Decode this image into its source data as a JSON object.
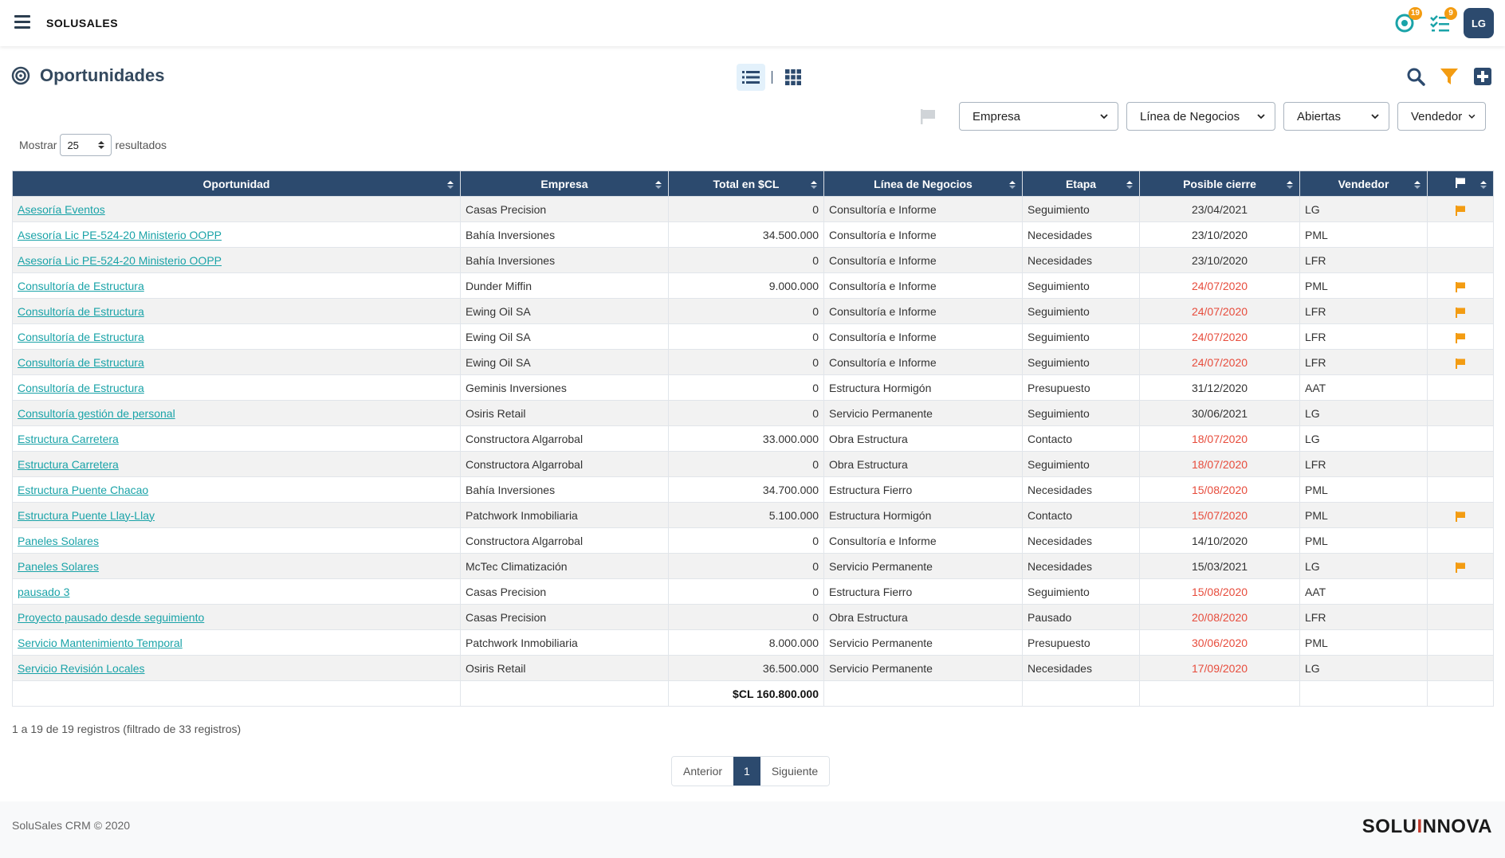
{
  "app": {
    "brand": "SOLUSALES",
    "user_initials": "LG",
    "badges": {
      "activity": "19",
      "tasks": "9"
    }
  },
  "page": {
    "title": "Oportunidades",
    "show_prefix": "Mostrar",
    "show_value": "25",
    "show_suffix": "resultados"
  },
  "filters": {
    "empresa": "Empresa",
    "linea": "Línea de Negocios",
    "estado": "Abiertas",
    "vendedor": "Vendedor"
  },
  "table": {
    "headers": [
      "Oportunidad",
      "Empresa",
      "Total en $CL",
      "Línea de Negocios",
      "Etapa",
      "Posible cierre",
      "Vendedor"
    ],
    "rows": [
      {
        "oportunidad": " Asesoría Eventos",
        "empresa": "Casas Precision",
        "total": "0",
        "linea": "Consultoría e Informe",
        "etapa": "Seguimiento",
        "cierre": "23/04/2021",
        "vendedor": "LG",
        "flag": true,
        "overdue": false
      },
      {
        "oportunidad": " Asesoría Lic PE-524-20 Ministerio OOPP",
        "empresa": "Bahía Inversiones",
        "total": "34.500.000",
        "linea": "Consultoría e Informe",
        "etapa": "Necesidades",
        "cierre": "23/10/2020",
        "vendedor": "PML",
        "flag": false,
        "overdue": false
      },
      {
        "oportunidad": " Asesoría Lic PE-524-20 Ministerio OOPP",
        "empresa": "Bahía Inversiones",
        "total": "0",
        "linea": "Consultoría e Informe",
        "etapa": "Necesidades",
        "cierre": "23/10/2020",
        "vendedor": "LFR",
        "flag": false,
        "overdue": false
      },
      {
        "oportunidad": " Consultoría de Estructura",
        "empresa": "Dunder Miffin",
        "total": "9.000.000",
        "linea": "Consultoría e Informe",
        "etapa": "Seguimiento",
        "cierre": "24/07/2020",
        "vendedor": "PML",
        "flag": true,
        "overdue": true
      },
      {
        "oportunidad": " Consultoría de Estructura",
        "empresa": "Ewing Oil SA",
        "total": "0",
        "linea": "Consultoría e Informe",
        "etapa": "Seguimiento",
        "cierre": "24/07/2020",
        "vendedor": "LFR",
        "flag": true,
        "overdue": true
      },
      {
        "oportunidad": " Consultoría de Estructura",
        "empresa": "Ewing Oil SA",
        "total": "0",
        "linea": "Consultoría e Informe",
        "etapa": "Seguimiento",
        "cierre": "24/07/2020",
        "vendedor": "LFR",
        "flag": true,
        "overdue": true
      },
      {
        "oportunidad": " Consultoría de Estructura",
        "empresa": "Ewing Oil SA",
        "total": "0",
        "linea": "Consultoría e Informe",
        "etapa": "Seguimiento",
        "cierre": "24/07/2020",
        "vendedor": "LFR",
        "flag": true,
        "overdue": true
      },
      {
        "oportunidad": " Consultoría de Estructura",
        "empresa": "Geminis Inversiones",
        "total": "0",
        "linea": "Estructura Hormigón",
        "etapa": "Presupuesto",
        "cierre": "31/12/2020",
        "vendedor": "AAT",
        "flag": false,
        "overdue": false
      },
      {
        "oportunidad": " Consultoría gestión de personal",
        "empresa": "Osiris Retail",
        "total": "0",
        "linea": "Servicio Permanente",
        "etapa": "Seguimiento",
        "cierre": "30/06/2021",
        "vendedor": "LG",
        "flag": false,
        "overdue": false
      },
      {
        "oportunidad": " Estructura Carretera",
        "empresa": "Constructora Algarrobal",
        "total": "33.000.000",
        "linea": "Obra Estructura",
        "etapa": "Contacto",
        "cierre": "18/07/2020",
        "vendedor": "LG",
        "flag": false,
        "overdue": true
      },
      {
        "oportunidad": " Estructura Carretera",
        "empresa": "Constructora Algarrobal",
        "total": "0",
        "linea": "Obra Estructura",
        "etapa": "Seguimiento",
        "cierre": "18/07/2020",
        "vendedor": "LFR",
        "flag": false,
        "overdue": true
      },
      {
        "oportunidad": " Estructura Puente Chacao",
        "empresa": "Bahía Inversiones",
        "total": "34.700.000",
        "linea": "Estructura Fierro",
        "etapa": "Necesidades",
        "cierre": "15/08/2020",
        "vendedor": "PML",
        "flag": false,
        "overdue": true
      },
      {
        "oportunidad": " Estructura Puente Llay-Llay",
        "empresa": "Patchwork Inmobiliaria",
        "total": "5.100.000",
        "linea": "Estructura Hormigón",
        "etapa": "Contacto",
        "cierre": "15/07/2020",
        "vendedor": "PML",
        "flag": true,
        "overdue": true
      },
      {
        "oportunidad": " Paneles Solares",
        "empresa": "Constructora Algarrobal",
        "total": "0",
        "linea": "Consultoría e Informe",
        "etapa": "Necesidades",
        "cierre": "14/10/2020",
        "vendedor": "PML",
        "flag": false,
        "overdue": false
      },
      {
        "oportunidad": " Paneles Solares",
        "empresa": "McTec Climatización",
        "total": "0",
        "linea": "Servicio Permanente",
        "etapa": "Necesidades",
        "cierre": "15/03/2021",
        "vendedor": "LG",
        "flag": true,
        "overdue": false
      },
      {
        "oportunidad": " pausado 3",
        "empresa": "Casas Precision",
        "total": "0",
        "linea": "Estructura Fierro",
        "etapa": "Seguimiento",
        "cierre": "15/08/2020",
        "vendedor": "AAT",
        "flag": false,
        "overdue": true
      },
      {
        "oportunidad": " Proyecto pausado desde seguimiento",
        "empresa": "Casas Precision",
        "total": "0",
        "linea": "Obra Estructura",
        "etapa": "Pausado",
        "cierre": "20/08/2020",
        "vendedor": "LFR",
        "flag": false,
        "overdue": true
      },
      {
        "oportunidad": " Servicio Mantenimiento Temporal",
        "empresa": "Patchwork Inmobiliaria",
        "total": "8.000.000",
        "linea": "Servicio Permanente",
        "etapa": "Presupuesto",
        "cierre": "30/06/2020",
        "vendedor": "PML",
        "flag": false,
        "overdue": true
      },
      {
        "oportunidad": " Servicio Revisión Locales",
        "empresa": "Osiris Retail",
        "total": "36.500.000",
        "linea": "Servicio Permanente",
        "etapa": "Necesidades",
        "cierre": "17/09/2020",
        "vendedor": "LG",
        "flag": false,
        "overdue": true
      }
    ],
    "total": "$CL 160.800.000"
  },
  "info": "1 a 19 de 19 registros (filtrado de 33 registros)",
  "pagination": {
    "prev": "Anterior",
    "current": "1",
    "next": "Siguiente"
  },
  "footer": {
    "copyright": "SoluSales CRM © 2020",
    "logo_left": "SOLU",
    "logo_accent": "I",
    "logo_right": "NNOVA"
  },
  "colors": {
    "primary": "#2c4a6e",
    "link": "#1aa3a8",
    "overdue": "#e74c3c",
    "flag": "#f39c12",
    "badge": "#f39c12"
  }
}
